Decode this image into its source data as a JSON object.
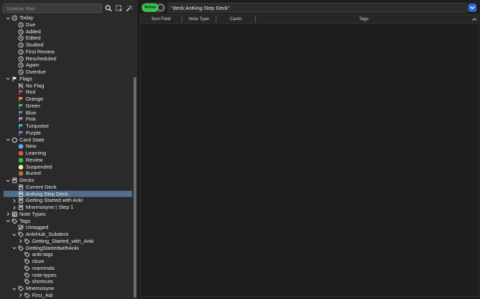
{
  "sidebar": {
    "filter_placeholder": "Sidebar filter",
    "toolbar_icons": [
      "search-icon",
      "select-icon",
      "magic-wand-icon"
    ],
    "items": [
      {
        "label": "Today",
        "level": 0,
        "expander": "down",
        "icon": "clock",
        "name": "today"
      },
      {
        "label": "Due",
        "level": 1,
        "icon": "clock",
        "name": "due"
      },
      {
        "label": "Added",
        "level": 1,
        "icon": "clock",
        "name": "added"
      },
      {
        "label": "Edited",
        "level": 1,
        "icon": "clock",
        "name": "edited"
      },
      {
        "label": "Studied",
        "level": 1,
        "icon": "clock",
        "name": "studied"
      },
      {
        "label": "First Review",
        "level": 1,
        "icon": "clock",
        "name": "first-review"
      },
      {
        "label": "Rescheduled",
        "level": 1,
        "icon": "clock",
        "name": "rescheduled"
      },
      {
        "label": "Again",
        "level": 1,
        "icon": "clock",
        "name": "again"
      },
      {
        "label": "Overdue",
        "level": 1,
        "icon": "clock",
        "name": "overdue"
      },
      {
        "label": "Flags",
        "level": 0,
        "expander": "down",
        "icon": "flag",
        "color": "#e6e6e6",
        "name": "flags"
      },
      {
        "label": "No Flag",
        "level": 1,
        "icon": "noflag",
        "color": "#cfcfcf",
        "name": "no-flag"
      },
      {
        "label": "Red",
        "level": 1,
        "icon": "flag",
        "color": "#e05050",
        "name": "red"
      },
      {
        "label": "Orange",
        "level": 1,
        "icon": "flag",
        "color": "#f0a030",
        "name": "orange"
      },
      {
        "label": "Green",
        "level": 1,
        "icon": "flag",
        "color": "#4cc050",
        "name": "green"
      },
      {
        "label": "Blue",
        "level": 1,
        "icon": "flag",
        "color": "#4a90e0",
        "name": "blue"
      },
      {
        "label": "Pink",
        "level": 1,
        "icon": "flag",
        "color": "#f080d0",
        "name": "pink"
      },
      {
        "label": "Turquoise",
        "level": 1,
        "icon": "flag",
        "color": "#40c8c0",
        "name": "turquoise"
      },
      {
        "label": "Purple",
        "level": 1,
        "icon": "flag",
        "color": "#a070e0",
        "name": "purple"
      },
      {
        "label": "Card State",
        "level": 0,
        "expander": "down",
        "icon": "circle-outline",
        "name": "card-state"
      },
      {
        "label": "New",
        "level": 1,
        "icon": "dot",
        "color": "#6aa6f8",
        "name": "new"
      },
      {
        "label": "Learning",
        "level": 1,
        "icon": "dot",
        "color": "#e8543c",
        "name": "learning"
      },
      {
        "label": "Review",
        "level": 1,
        "icon": "dot",
        "color": "#2ebf52",
        "name": "review"
      },
      {
        "label": "Suspended",
        "level": 1,
        "icon": "dot",
        "color": "#f5e6a8",
        "name": "suspended"
      },
      {
        "label": "Buried",
        "level": 1,
        "icon": "dot",
        "color": "#b8743c",
        "name": "buried"
      },
      {
        "label": "Decks",
        "level": 0,
        "expander": "down",
        "icon": "deck",
        "name": "decks"
      },
      {
        "label": "Current Deck",
        "level": 1,
        "icon": "deck",
        "name": "current-deck"
      },
      {
        "label": "AnKing Step Deck",
        "level": 1,
        "icon": "deck",
        "selected": true,
        "name": "anking-step-deck"
      },
      {
        "label": "Getting Started with Anki",
        "level": 1,
        "expander": "right",
        "icon": "deck",
        "name": "getting-started-with-anki"
      },
      {
        "label": "Mnemosyne | Step 1",
        "level": 1,
        "expander": "right",
        "icon": "deck",
        "name": "mnemosyne-step-1"
      },
      {
        "label": "Note Types",
        "level": 0,
        "expander": "right",
        "icon": "notetype",
        "name": "note-types"
      },
      {
        "label": "Tags",
        "level": 0,
        "expander": "down",
        "icon": "tag",
        "name": "tags"
      },
      {
        "label": "Untagged",
        "level": 1,
        "icon": "tag-off",
        "name": "untagged"
      },
      {
        "label": "AnkiHub_Subdeck",
        "level": 1,
        "expander": "down",
        "icon": "tag",
        "name": "ankihub-subdeck"
      },
      {
        "label": "Getting_Started_with_Anki",
        "level": 2,
        "expander": "right",
        "icon": "tag",
        "name": "getting-started-with-anki-tag"
      },
      {
        "label": "GettingStartedwithAnki",
        "level": 1,
        "expander": "down",
        "icon": "tag",
        "name": "gettingstartedwithanki"
      },
      {
        "label": "anki-tags",
        "level": 2,
        "icon": "tag",
        "name": "anki-tags"
      },
      {
        "label": "cloze",
        "level": 2,
        "icon": "tag",
        "name": "cloze"
      },
      {
        "label": "mammals",
        "level": 2,
        "icon": "tag",
        "name": "mammals"
      },
      {
        "label": "note-types",
        "level": 2,
        "icon": "tag",
        "name": "note-types-tag"
      },
      {
        "label": "shortcuts",
        "level": 2,
        "icon": "tag",
        "name": "shortcuts"
      },
      {
        "label": "Mnemosyne",
        "level": 1,
        "expander": "down",
        "icon": "tag",
        "name": "mnemosyne-tag"
      },
      {
        "label": "First_Aid",
        "level": 2,
        "expander": "right",
        "icon": "tag",
        "name": "first-aid"
      }
    ]
  },
  "main": {
    "toggle_label": "Notes",
    "toggle_color": "#38c44f",
    "search_value": "\"deck:AnKing Step Deck\"",
    "dropdown_icon": "chevron-down-icon",
    "dropdown_color": "#2a6bd8",
    "columns": [
      "Sort Field",
      "Note Type",
      "Cards",
      "Tags"
    ],
    "sort_indicator_icon": "sort-up-icon"
  }
}
